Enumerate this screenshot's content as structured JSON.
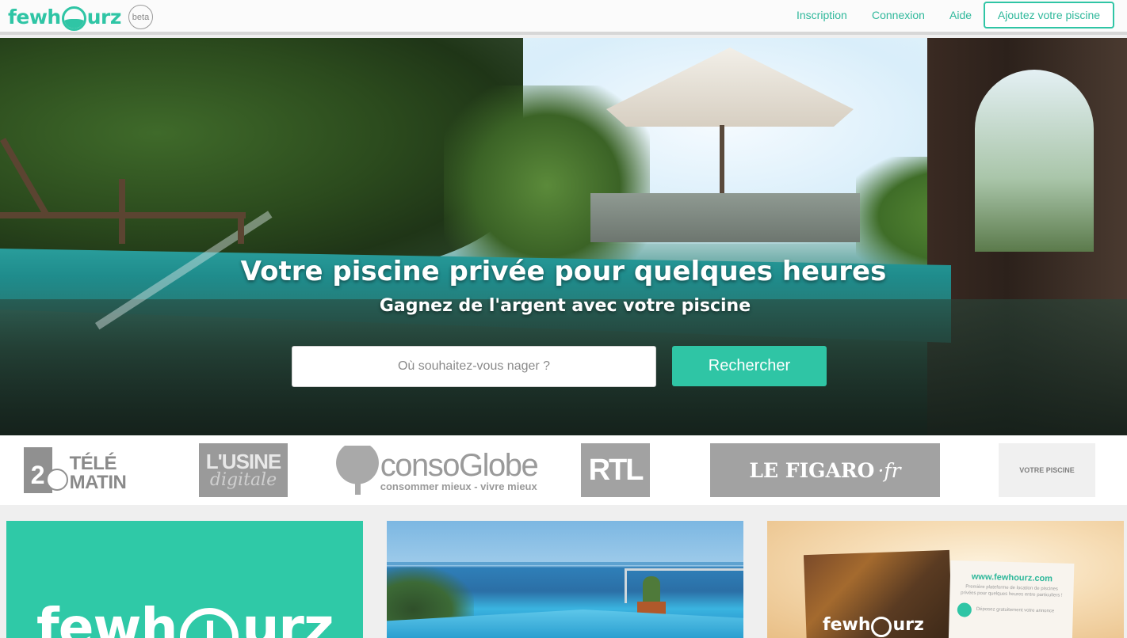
{
  "header": {
    "logo": {
      "pre": "fewh",
      "post": "urz"
    },
    "beta": "beta",
    "nav": {
      "inscription": "Inscription",
      "connexion": "Connexion",
      "aide": "Aide",
      "cta": "Ajoutez votre piscine"
    }
  },
  "hero": {
    "title": "Votre piscine privée pour quelques heures",
    "subtitle": "Gagnez de l'argent avec votre piscine",
    "search_placeholder": "Où souhaitez-vous nager ?",
    "search_value": "",
    "search_button": "Rechercher"
  },
  "press": {
    "telematin": {
      "num": "2",
      "line1": "TÉLÉ",
      "line2": "MATIN"
    },
    "usine": {
      "line1": "L'USINE",
      "line2": "digitale"
    },
    "conso": {
      "word": "consoGlobe",
      "tagline": "consommer mieux - vivre mieux"
    },
    "rtl": "RTL",
    "figaro": {
      "name": "LE FIGARO",
      "suffix": "·fr"
    },
    "votrepiscine": "VOTRE PISCINE"
  },
  "cards": {
    "card1_logo": {
      "pre": "fewh",
      "post": "urz"
    },
    "card3_logo": {
      "pre": "fewh",
      "post": "urz"
    },
    "card3_url": "www.fewhourz.com",
    "card3_tagline": "Première plateforme de location de piscines privées pour quelques heures entre particuliers !",
    "card3_row": "Déposez gratuitement votre annonce"
  },
  "colors": {
    "brand": "#2fc5a5",
    "brand_text": "#2fb89b"
  }
}
